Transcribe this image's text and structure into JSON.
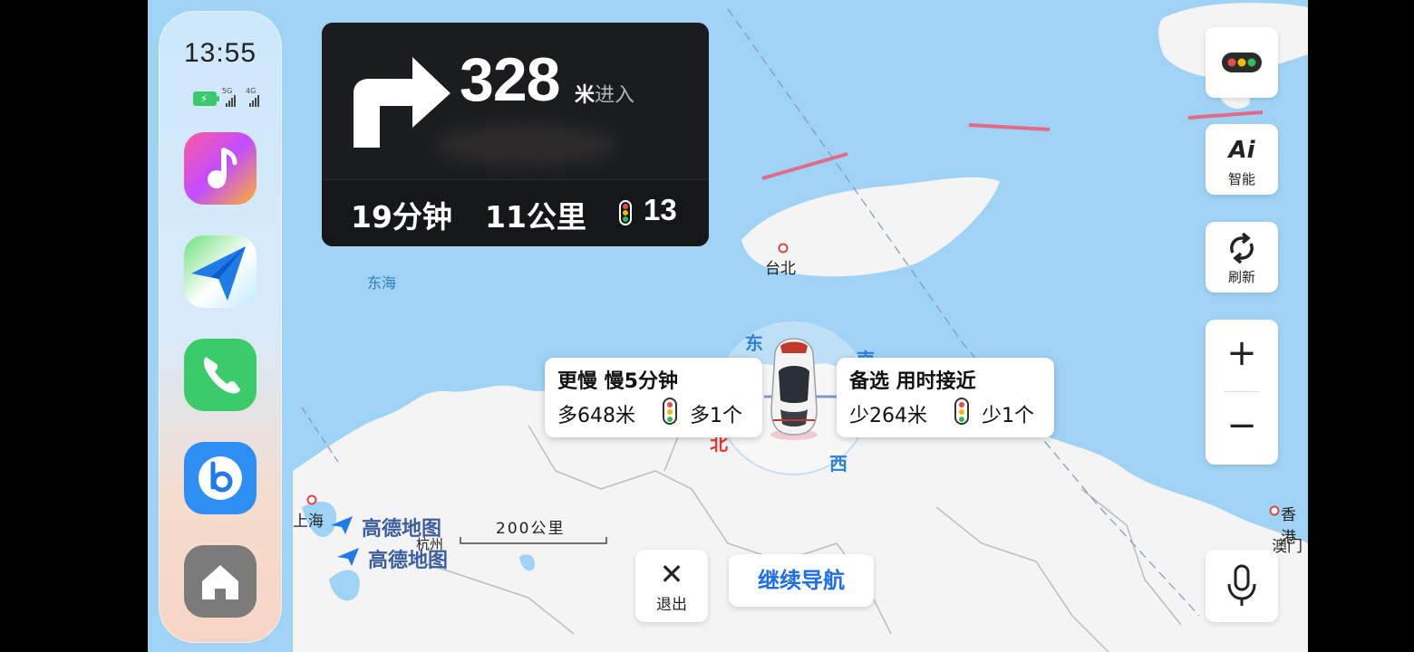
{
  "status_bar": {
    "time": "13:55",
    "signal_1": "5G",
    "signal_2": "4G"
  },
  "dock": {
    "apps": [
      {
        "name": "music",
        "icon": "music-note-icon"
      },
      {
        "name": "navigation",
        "icon": "paper-plane-icon"
      },
      {
        "name": "phone",
        "icon": "phone-icon"
      },
      {
        "name": "bixby",
        "icon": "bixby-icon"
      },
      {
        "name": "home",
        "icon": "home-icon"
      }
    ]
  },
  "navigation": {
    "turn_icon": "turn-right-arrow-icon",
    "distance": "328",
    "distance_unit": "米",
    "distance_suffix": "进入",
    "remaining_time": "19分钟",
    "remaining_distance": "11公里",
    "traffic_lights": "13"
  },
  "right_controls": {
    "traffic_icon": "traffic-light-icon",
    "ai_label": "智能",
    "ai_icon_text": "Ai",
    "refresh_label": "刷新",
    "zoom_in": "+",
    "zoom_out": "−"
  },
  "routes": {
    "slower": {
      "title": "更慢 慢5分钟",
      "distance": "多648米",
      "lights": "多1个"
    },
    "alternative": {
      "title": "备选 用时接近",
      "distance": "少264米",
      "lights": "少1个"
    }
  },
  "compass": {
    "east": "东",
    "south": "南",
    "west": "西",
    "north": "北"
  },
  "map_labels": {
    "sea": "东海",
    "taipei": "台北",
    "shanghai": "上海",
    "hangzhou": "杭州",
    "hongkong": "香港",
    "macau": "澳门",
    "scale": "200公里",
    "brand": "高德地图"
  },
  "bottom_controls": {
    "exit_label": "退出",
    "continue_label": "继续导航"
  },
  "colors": {
    "sea": "#9fd3f5",
    "land": "#f4f4f4",
    "accent_blue": "#1e6ee8",
    "traffic_red": "#e94b4b",
    "traffic_yellow": "#f5b800",
    "traffic_green": "#2fbf5a"
  }
}
